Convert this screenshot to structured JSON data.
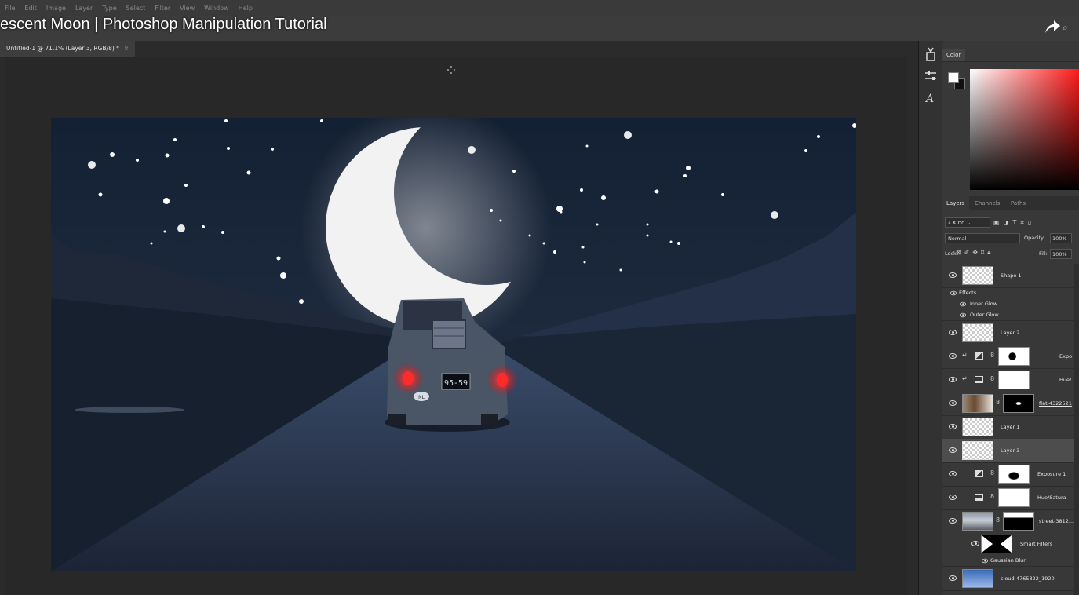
{
  "menubar": {
    "items": [
      "File",
      "Edit",
      "Image",
      "Layer",
      "Type",
      "Select",
      "Filter",
      "View",
      "Window",
      "Help"
    ]
  },
  "video": {
    "title": "escent Moon | Photoshop Manipulation Tutorial"
  },
  "document": {
    "tab_label": "Untitled-1 @ 71.1% (Layer 3, RGB/8) *",
    "close": "×"
  },
  "canvas_content": {
    "license_plate": "95-59",
    "country_badge": "NL"
  },
  "toolstrip": {
    "icons": [
      "gradient-tool-icon",
      "adjust-sliders-icon",
      "glyph-icon"
    ]
  },
  "color_panel": {
    "tab": "Color"
  },
  "layers_panel": {
    "tabs": [
      "Layers",
      "Channels",
      "Paths"
    ],
    "kind": "Kind",
    "blend_mode": "Normal",
    "opacity_label": "Opacity:",
    "opacity": "100%",
    "lock_label": "Lock:",
    "fill_label": "Fill:",
    "fill": "100%",
    "layers": [
      {
        "name": "Shape 1"
      },
      {
        "name": "Effects"
      },
      {
        "name": "Inner Glow"
      },
      {
        "name": "Outer Glow"
      },
      {
        "name": "Layer 2"
      },
      {
        "name": "Expo"
      },
      {
        "name": "Hue/"
      },
      {
        "name": "flat-4322521"
      },
      {
        "name": "Layer 1"
      },
      {
        "name": "Layer 3"
      },
      {
        "name": "Exposure 1"
      },
      {
        "name": "Hue/Satura"
      },
      {
        "name": "street-3812..."
      },
      {
        "name": "Smart Filters"
      },
      {
        "name": "Gaussian Blur"
      },
      {
        "name": "cloud-4765322_1920"
      }
    ]
  },
  "colors": {
    "accent_red": "#ff2020",
    "sky": "#1b2638",
    "panel": "#383838"
  }
}
